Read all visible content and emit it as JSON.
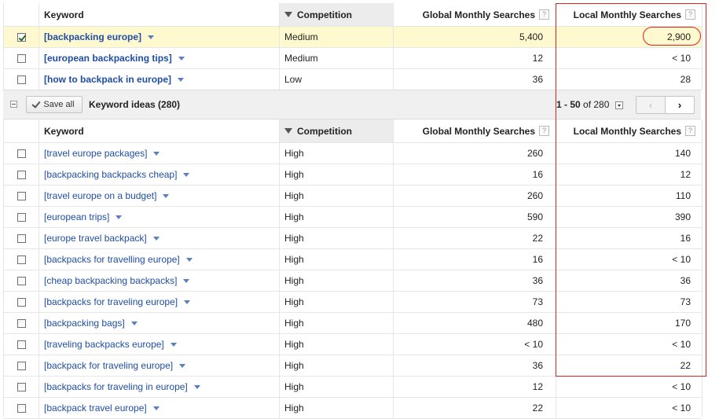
{
  "headers": {
    "keyword": "Keyword",
    "competition": "Competition",
    "global": "Global Monthly Searches",
    "local": "Local Monthly Searches",
    "help": "?"
  },
  "top_rows": [
    {
      "keyword": "[backpacking europe]",
      "competition": "Medium",
      "global": "5,400",
      "local": "2,900",
      "checked": true
    },
    {
      "keyword": "[european backpacking tips]",
      "competition": "Medium",
      "global": "12",
      "local": "< 10",
      "checked": false
    },
    {
      "keyword": "[how to backpack in europe]",
      "competition": "Low",
      "global": "36",
      "local": "28",
      "checked": false
    }
  ],
  "toolbar": {
    "save_all": "Save all",
    "ideas_title": "Keyword ideas (280)",
    "pager_range": "1 - 50",
    "pager_of": " of 280",
    "prev": "‹",
    "next": "›"
  },
  "idea_rows": [
    {
      "keyword": "[travel europe packages]",
      "competition": "High",
      "global": "260",
      "local": "140"
    },
    {
      "keyword": "[backpacking backpacks cheap]",
      "competition": "High",
      "global": "16",
      "local": "12"
    },
    {
      "keyword": "[travel europe on a budget]",
      "competition": "High",
      "global": "260",
      "local": "110"
    },
    {
      "keyword": "[european trips]",
      "competition": "High",
      "global": "590",
      "local": "390"
    },
    {
      "keyword": "[europe travel backpack]",
      "competition": "High",
      "global": "22",
      "local": "16"
    },
    {
      "keyword": "[backpacks for travelling europe]",
      "competition": "High",
      "global": "16",
      "local": "< 10"
    },
    {
      "keyword": "[cheap backpacking backpacks]",
      "competition": "High",
      "global": "36",
      "local": "36"
    },
    {
      "keyword": "[backpacks for traveling europe]",
      "competition": "High",
      "global": "73",
      "local": "73"
    },
    {
      "keyword": "[backpacking bags]",
      "competition": "High",
      "global": "480",
      "local": "170"
    },
    {
      "keyword": "[traveling backpacks europe]",
      "competition": "High",
      "global": "< 10",
      "local": "< 10"
    },
    {
      "keyword": "[backpack for traveling europe]",
      "competition": "High",
      "global": "36",
      "local": "22"
    },
    {
      "keyword": "[backpacks for traveling in europe]",
      "competition": "High",
      "global": "12",
      "local": "< 10"
    },
    {
      "keyword": "[backpack travel europe]",
      "competition": "High",
      "global": "22",
      "local": "< 10"
    }
  ],
  "colors": {
    "highlight": "#fff9d0",
    "link": "#1f4ea3",
    "annotation": "#dd2222"
  }
}
